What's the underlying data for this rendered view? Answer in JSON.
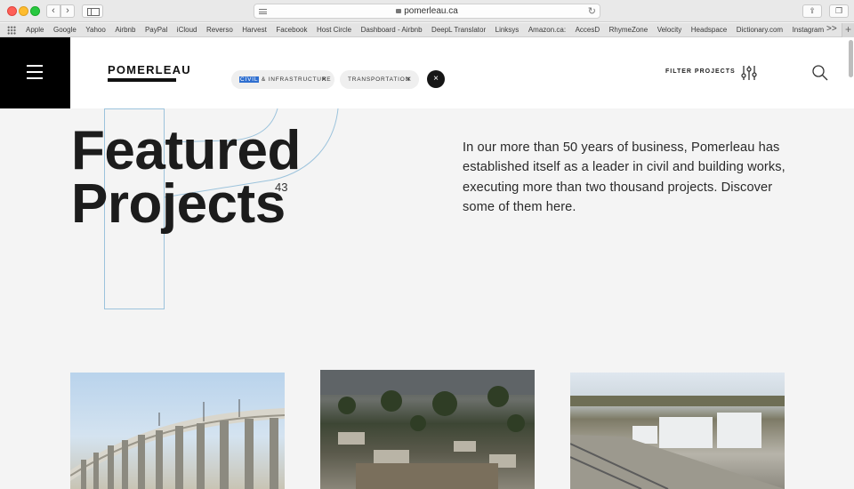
{
  "browser": {
    "url": "pomerleau.ca",
    "bookmarks": [
      "Apple",
      "Google",
      "Yahoo",
      "Airbnb",
      "PayPal",
      "iCloud",
      "Reverso",
      "Harvest",
      "Facebook",
      "Host Circle",
      "Dashboard - Airbnb",
      "DeepL Translator",
      "Linksys",
      "Amazon.ca:",
      "AccesD",
      "RhymeZone",
      "Velocity",
      "Headspace",
      "Dictionary.com",
      "Instagram"
    ],
    "more_label": ">>",
    "add_label": "+"
  },
  "header": {
    "logo": "POMERLEAU",
    "filters": [
      {
        "highlight": "CIVIL",
        "rest": " & INFRASTRUCTURE",
        "remove_glyph": "×"
      },
      {
        "highlight": "",
        "rest": "TRANSPORTATION",
        "remove_glyph": "×"
      }
    ],
    "clear_glyph": "×",
    "filter_label": "FILTER PROJECTS"
  },
  "hero": {
    "title_line1": "Featured",
    "title_line2": "Projects",
    "count": "43",
    "description": "In our more than 50 years of business, Pomerleau has established itself as a leader in civil and building works, executing more than two thousand projects. Discover some of them here."
  },
  "colors": {
    "page_bg": "#f4f4f4",
    "menu_bg": "#000000",
    "highlight": "#2f6fd0",
    "deco_line": "#9cc3dc"
  }
}
